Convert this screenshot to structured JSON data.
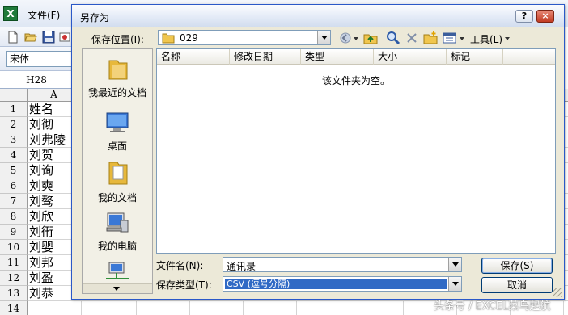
{
  "excel": {
    "file_menu": "文件(F)",
    "font_name": "宋体",
    "name_box": "H28",
    "column_a": "A",
    "rows": [
      {
        "n": "1",
        "a": "姓名"
      },
      {
        "n": "2",
        "a": "刘彻"
      },
      {
        "n": "3",
        "a": "刘弗陵"
      },
      {
        "n": "4",
        "a": "刘贺"
      },
      {
        "n": "5",
        "a": "刘询"
      },
      {
        "n": "6",
        "a": "刘奭"
      },
      {
        "n": "7",
        "a": "刘骜"
      },
      {
        "n": "8",
        "a": "刘欣"
      },
      {
        "n": "9",
        "a": "刘衎"
      },
      {
        "n": "10",
        "a": "刘婴"
      },
      {
        "n": "11",
        "a": "刘邦"
      },
      {
        "n": "12",
        "a": "刘盈"
      },
      {
        "n": "13",
        "a": "刘恭"
      },
      {
        "n": "14",
        "a": ""
      }
    ]
  },
  "dialog": {
    "title": "另存为",
    "help_button": "?",
    "close_button": "×",
    "save_in_label": "保存位置(I):",
    "save_in_value": "029",
    "tools_label": "工具(L)",
    "places": [
      {
        "label": "我最近的文档",
        "icon": "recent-folder-icon"
      },
      {
        "label": "桌面",
        "icon": "desktop-icon"
      },
      {
        "label": "我的文档",
        "icon": "my-documents-icon"
      },
      {
        "label": "我的电脑",
        "icon": "my-computer-icon"
      },
      {
        "label": "",
        "icon": "network-places-icon"
      }
    ],
    "columns": [
      "名称",
      "修改日期",
      "类型",
      "大小",
      "标记"
    ],
    "empty_message": "该文件夹为空。",
    "filename_label": "文件名(N):",
    "filename_value": "通讯录",
    "filetype_label": "保存类型(T):",
    "filetype_value": "CSV (逗号分隔)",
    "save_button": "保存(S)",
    "cancel_button": "取消"
  },
  "watermark": "头条号 / EXCEL菜鸟起航",
  "colors": {
    "selection": "#316ac5",
    "dialog_bg": "#ece9d8",
    "title_bar": "#dde6f4"
  }
}
